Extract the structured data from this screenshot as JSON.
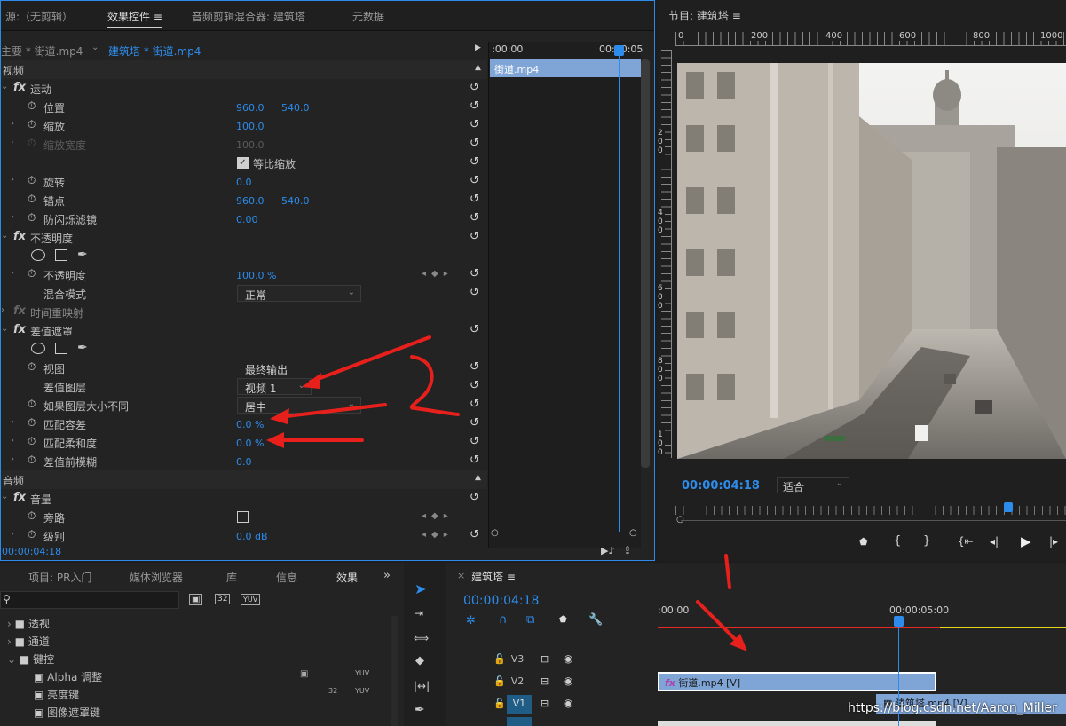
{
  "effect_controls": {
    "tabs": [
      "源:（无剪辑）",
      "效果控件",
      "音频剪辑混合器: 建筑塔",
      "元数据"
    ],
    "menu_icon": "≡",
    "clip_master": "主要 * 街道.mp4",
    "clip_seq": "建筑塔 * 街道.mp4",
    "ruler_start": ":00:00",
    "ruler_end": "00:00:05",
    "clip_bar": "街道.mp4",
    "video_header": "视频",
    "audio_header": "音频",
    "motion": "运动",
    "position": "位置",
    "position_x": "960.0",
    "position_y": "540.0",
    "scale": "缩放",
    "scale_val": "100.0",
    "scale_width": "缩放宽度",
    "scale_width_val": "100.0",
    "uniform_scale": "等比缩放",
    "rotation": "旋转",
    "rotation_val": "0.0",
    "anchor": "锚点",
    "anchor_x": "960.0",
    "anchor_y": "540.0",
    "anti_flicker": "防闪烁滤镜",
    "anti_flicker_val": "0.00",
    "opacity_group": "不透明度",
    "opacity": "不透明度",
    "opacity_val": "100.0 %",
    "blend_mode": "混合模式",
    "blend_val": "正常",
    "time_remap": "时间重映射",
    "diff_matte": "差值遮罩",
    "view": "视图",
    "view_val": "最终输出",
    "diff_layer": "差值图层",
    "diff_layer_val": "视频 1",
    "if_size_differs": "如果图层大小不同",
    "if_size_val": "居中",
    "match_tolerance": "匹配容差",
    "match_tolerance_val": "0.0 %",
    "match_softness": "匹配柔和度",
    "match_softness_val": "0.0 %",
    "blur_before": "差值前模糊",
    "blur_before_val": "0.0",
    "volume": "音量",
    "bypass": "旁路",
    "level": "级别",
    "level_val": "0.0 dB",
    "timecode": "00:00:04:18"
  },
  "program": {
    "title": "节目: 建筑塔",
    "ruler_labels": [
      "0",
      "200",
      "400",
      "600",
      "800",
      "1000"
    ],
    "vruler_labels": [
      "2",
      "0",
      "0",
      "4",
      "0",
      "0",
      "6",
      "0",
      "0",
      "8",
      "0",
      "0",
      "1",
      "0",
      "0"
    ],
    "timecode": "00:00:04:18",
    "fit": "适合"
  },
  "project": {
    "tabs": [
      "项目: PR入门",
      "媒体浏览器",
      "库",
      "信息",
      "效果"
    ],
    "items": [
      "透视",
      "通道",
      "键控",
      "Alpha 调整",
      "亮度键",
      "图像遮罩键"
    ]
  },
  "timeline": {
    "title": "建筑塔",
    "timecode": "00:00:04:18",
    "ruler_start": ":00:00",
    "ruler_mid": "00:00:05:00",
    "tracks": [
      "V3",
      "V2",
      "V1"
    ],
    "clip_v2": "街道.mp4 [V]",
    "clip_v1": "建筑塔.mp4 [V]"
  },
  "watermark": "https://blog.csdn.net/Aaron_Miller",
  "colors": {
    "accent": "#2d8ceb",
    "annotation": "#e8201c",
    "clip": "#7fa4d6"
  }
}
